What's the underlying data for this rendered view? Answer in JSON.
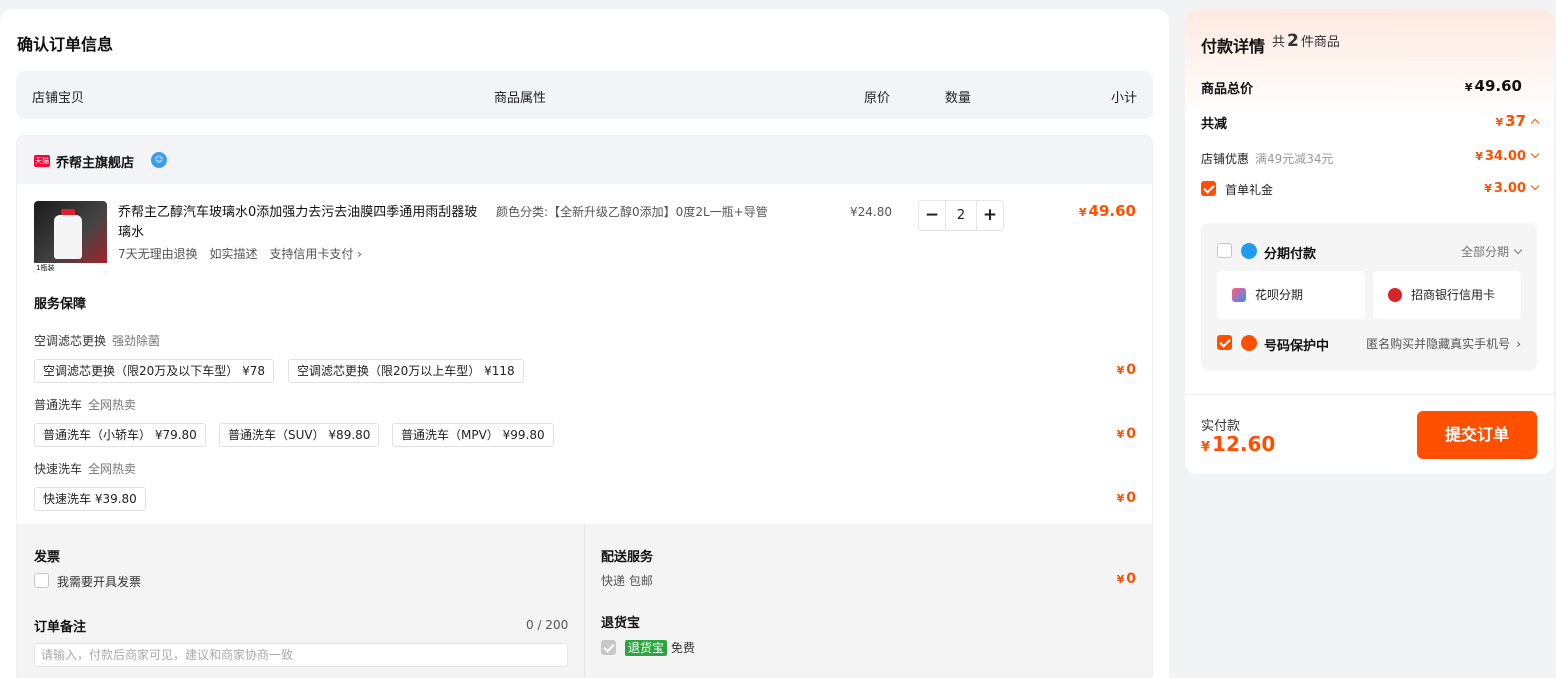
{
  "page_title": "确认订单信息",
  "table_headers": {
    "item": "店铺宝贝",
    "attr": "商品属性",
    "price": "原价",
    "qty": "数量",
    "subtotal": "小计"
  },
  "shop": {
    "badge": "天猫",
    "name": "乔帮主旗舰店"
  },
  "product": {
    "thumb_label": "1瓶装",
    "title": "乔帮主乙醇汽车玻璃水0添加强力去污去油膜四季通用雨刮器玻璃水",
    "tags": [
      "7天无理由退换",
      "如实描述",
      "支持信用卡支付 ›"
    ],
    "attr": "颜色分类:【全新升级乙醇0添加】0度2L一瓶+导管",
    "price": "¥24.80",
    "qty": "2",
    "minus": "−",
    "plus": "+",
    "subtotal_yen": "¥",
    "subtotal": "49.60"
  },
  "services": {
    "title": "服务保障",
    "groups": [
      {
        "name": "空调滤芯更换",
        "sub": "强劲除菌",
        "options": [
          "空调滤芯更换（限20万及以下车型）  ¥78",
          "空调滤芯更换（限20万以上车型）  ¥118"
        ],
        "total": "0"
      },
      {
        "name": "普通洗车",
        "sub": "全网热卖",
        "options": [
          "普通洗车（小轿车）  ¥79.80",
          "普通洗车（SUV）  ¥89.80",
          "普通洗车（MPV）  ¥99.80"
        ],
        "total": "0"
      },
      {
        "name": "快速洗车",
        "sub": "全网热卖",
        "options": [
          "快速洗车  ¥39.80"
        ],
        "total": "0"
      }
    ]
  },
  "invoice": {
    "title": "发票",
    "checkbox_label": "我需要开具发票"
  },
  "remark": {
    "title": "订单备注",
    "counter": "0 / 200",
    "placeholder": "请输入，付款后商家可见，建议和商家协商一致"
  },
  "delivery": {
    "title": "配送服务",
    "text": "快递 包邮",
    "cost": "0"
  },
  "return": {
    "title": "退货宝",
    "badge": "退货宝",
    "text": "免费"
  },
  "payment": {
    "title": "付款详情",
    "count_prefix": "共",
    "count": "2",
    "count_suffix": "件商品",
    "total_label": "商品总价",
    "total_value": "49.60",
    "discount_label": "共减",
    "discount_value": "37",
    "shop_discount_label": "店铺优惠",
    "shop_discount_note": "满49元减34元",
    "shop_discount_value": "34.00",
    "first_order_label": "首单礼金",
    "first_order_value": "3.00",
    "installment_label": "分期付款",
    "installment_all": "全部分期",
    "huabei": "花呗分期",
    "cmb": "招商银行信用卡",
    "number_protect_label": "号码保护中",
    "number_protect_note": "匿名购买并隐藏真实手机号",
    "actual_label": "实付款",
    "actual_value": "12.60",
    "submit": "提交订单"
  },
  "colors": {
    "accent": "#ff5000",
    "badge_green": "#2da641",
    "tmall_red": "#ff0036"
  }
}
